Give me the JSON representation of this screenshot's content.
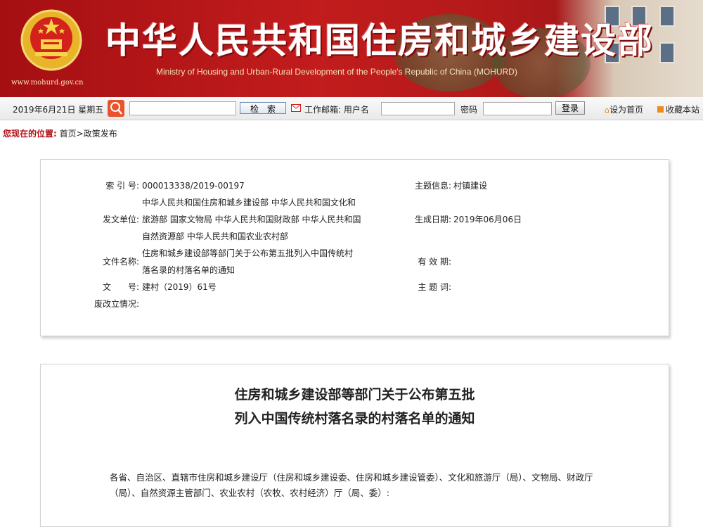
{
  "header": {
    "site_url": "www.mohurd.gov.cn",
    "title_cn": "中华人民共和国住房和城乡建设部",
    "title_en": "Ministry of Housing and Urban-Rural Development of the People's Republic of China (MOHURD)",
    "emblem_icon": "national-emblem-icon"
  },
  "toolbar": {
    "date": "2019年6月21日 星期五",
    "search_button": "检　索",
    "mail_label": "工作邮箱: 用户名",
    "password_label": "密码",
    "login_button": "登录",
    "set_home": "设为首页",
    "bookmark": "收藏本站"
  },
  "breadcrumb": {
    "label": "您现在的位置:",
    "path": "首页>政策发布"
  },
  "info": {
    "index_label": "索 引 号:",
    "index_value": "000013338/2019-00197",
    "topic_label": "主题信息:",
    "topic_value": "村镇建设",
    "issuer_label": "发文单位:",
    "issuer_line1": "中华人民共和国住房和城乡建设部 中华人民共和国文化和",
    "issuer_line2": "旅游部 国家文物局 中华人民共和国财政部 中华人民共和国",
    "issuer_line3": "自然资源部 中华人民共和国农业农村部",
    "date_label": "生成日期:",
    "date_value": "2019年06月06日",
    "filename_label": "文件名称:",
    "filename_line1": "住房和城乡建设部等部门关于公布第五批列入中国传统村",
    "filename_line2": "落名录的村落名单的通知",
    "validity_label": "有 效 期:",
    "docno_label": "文　　号:",
    "docno_value": "建村（2019）61号",
    "subject_label": "主 题 词:",
    "status_label": "废改立情况:"
  },
  "article": {
    "title_line1": "住房和城乡建设部等部门关于公布第五批",
    "title_line2": "列入中国传统村落名录的村落名单的通知",
    "body_line1": "各省、自治区、直辖市住房和城乡建设厅（住房和城乡建设委、住房和城乡建设管委）、文化和旅游厅（局）、文物局、财政厅",
    "body_line2": "（局）、自然资源主管部门、农业农村（农牧、农村经济）厅（局、委）:"
  }
}
